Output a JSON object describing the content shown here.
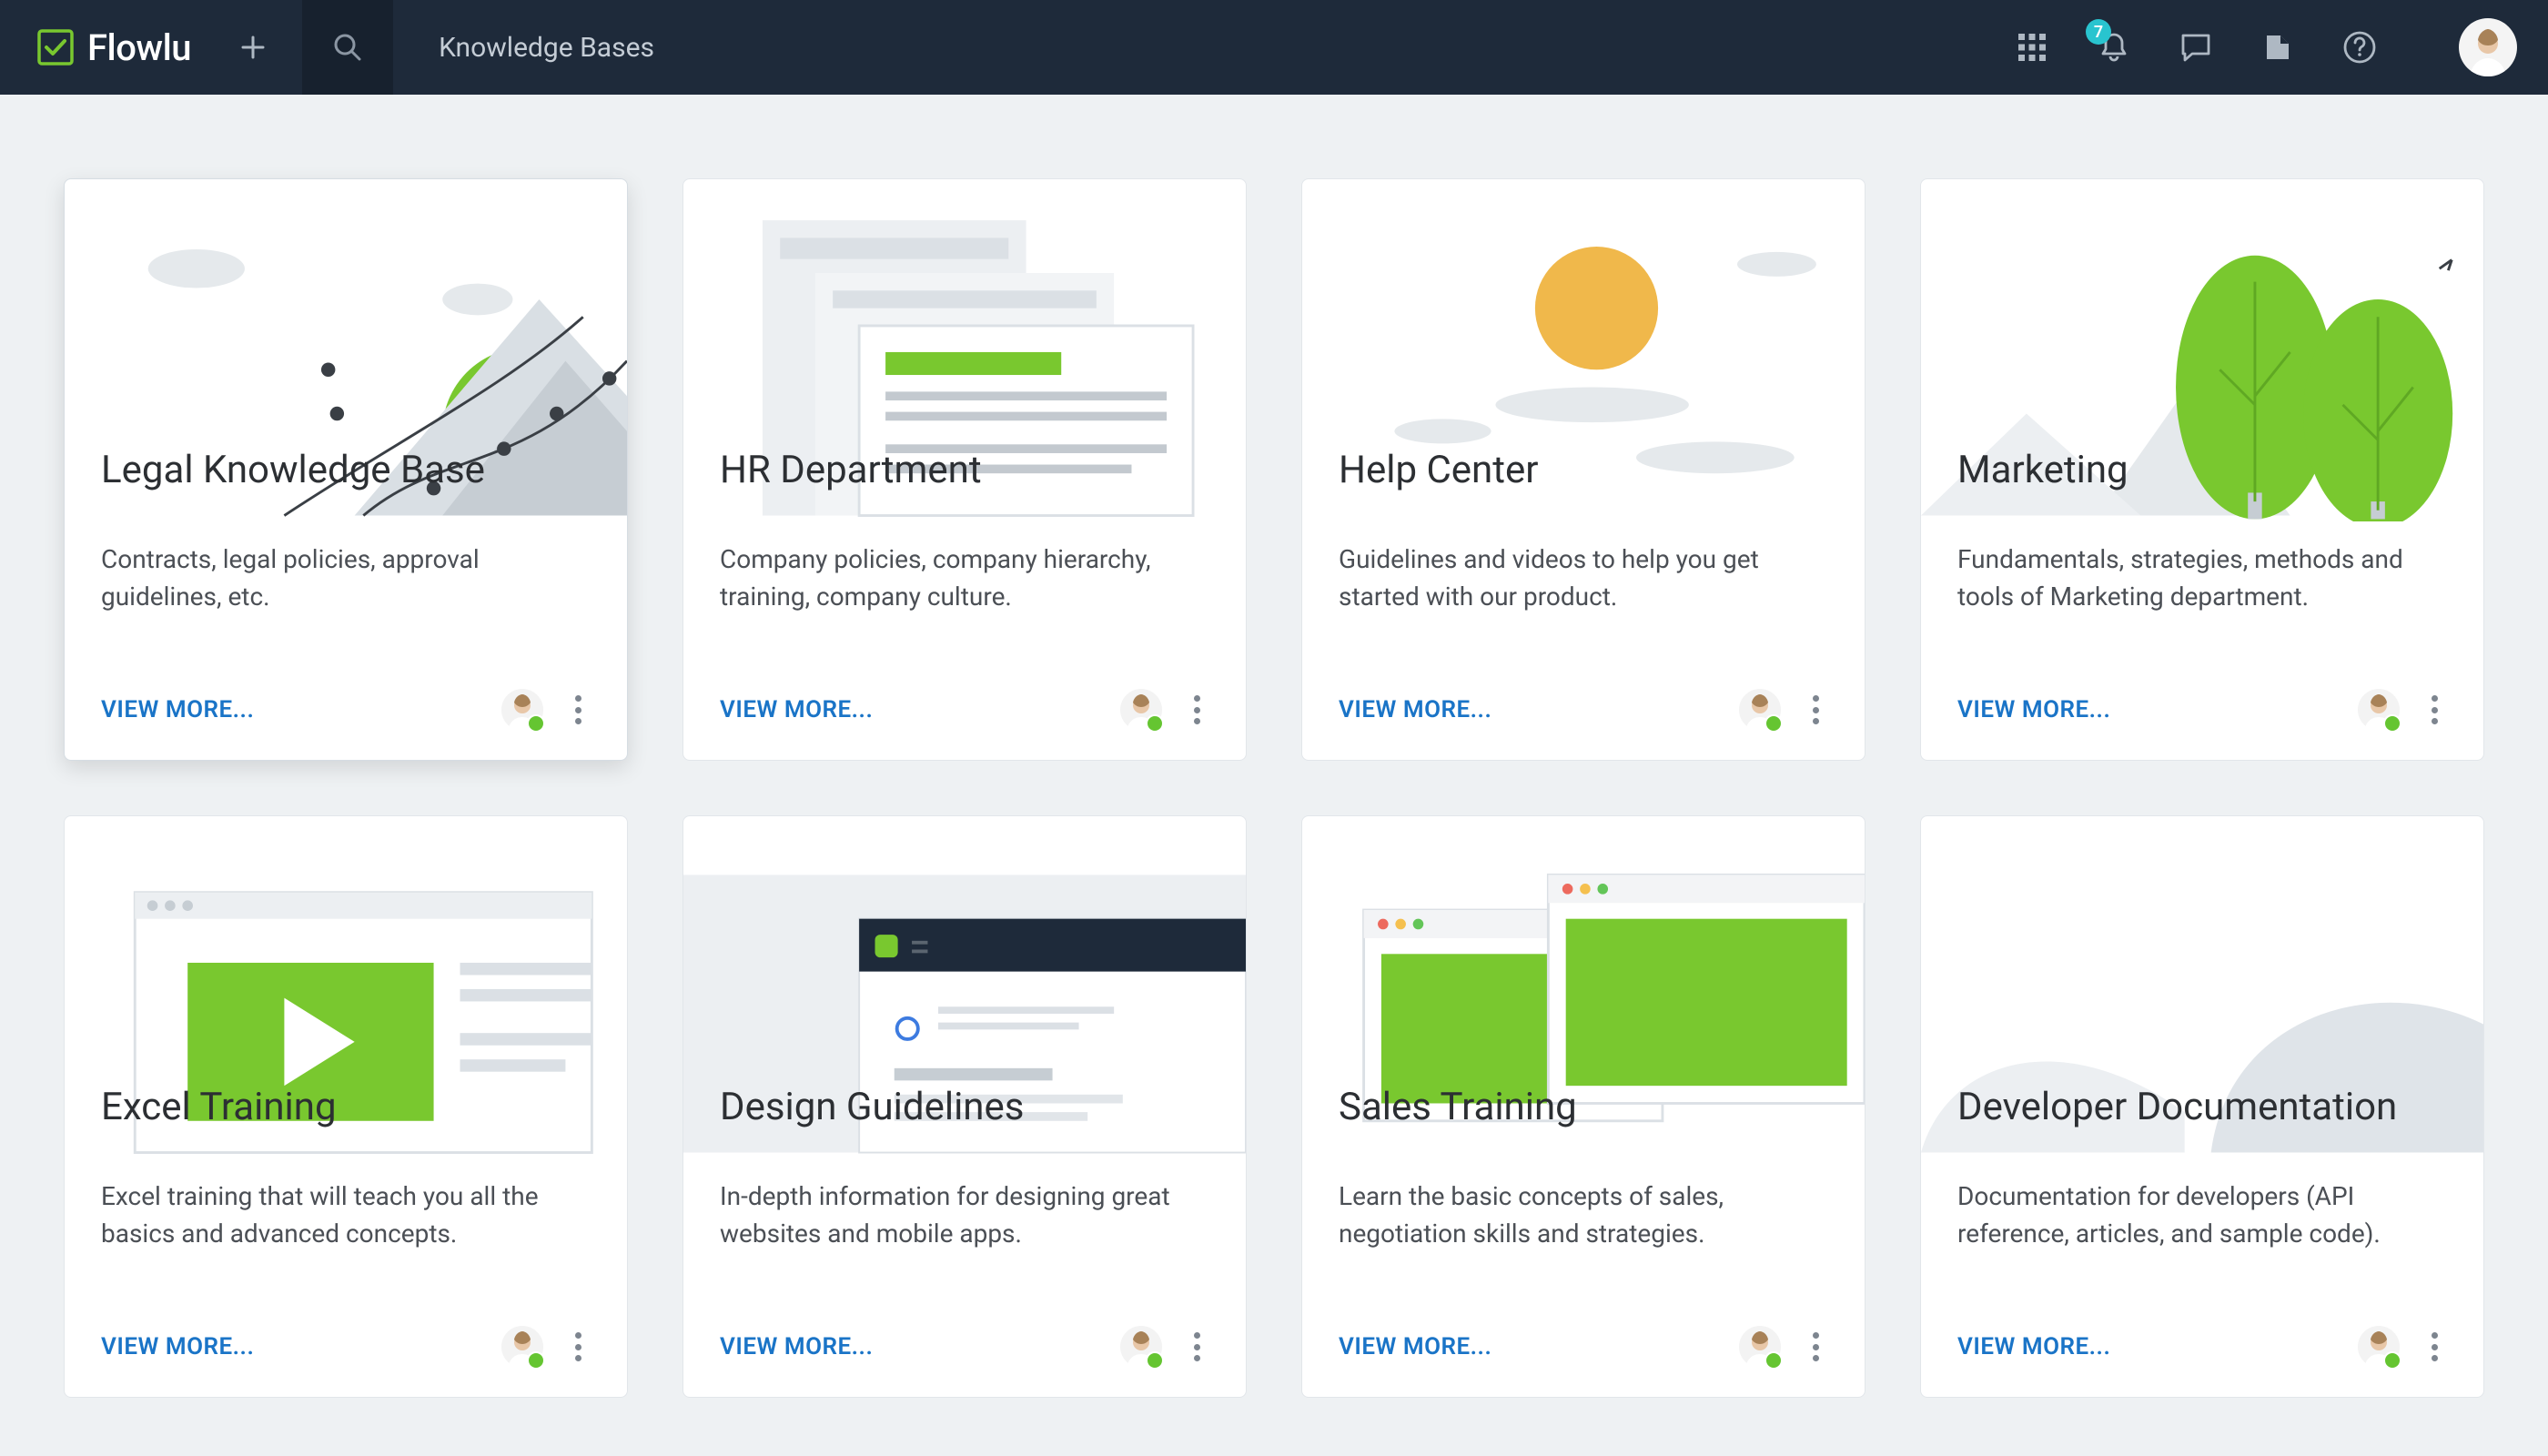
{
  "app": {
    "name": "Flowlu"
  },
  "header": {
    "page_title": "Knowledge Bases",
    "notification_count": "7"
  },
  "common": {
    "view_more_label": "VIEW MORE..."
  },
  "cards": [
    {
      "title": "Legal Knowledge Base",
      "desc": "Contracts, legal policies, approval guidelines, etc."
    },
    {
      "title": "HR Department",
      "desc": "Company policies, company hierarchy, training, company culture."
    },
    {
      "title": "Help Center",
      "desc": "Guidelines and videos to help you get started with our product."
    },
    {
      "title": "Marketing",
      "desc": "Fundamentals, strategies, methods and tools of Marketing department."
    },
    {
      "title": "Excel Training",
      "desc": "Excel training that will teach you all the basics and advanced concepts."
    },
    {
      "title": "Design Guidelines",
      "desc": "In-depth information for designing great websites and mobile apps."
    },
    {
      "title": "Sales Training",
      "desc": "Learn the basic concepts of sales, negotiation skills and strategies."
    },
    {
      "title": "Developer Documentation",
      "desc": "Documentation for developers (API reference, articles, and sample code)."
    }
  ]
}
